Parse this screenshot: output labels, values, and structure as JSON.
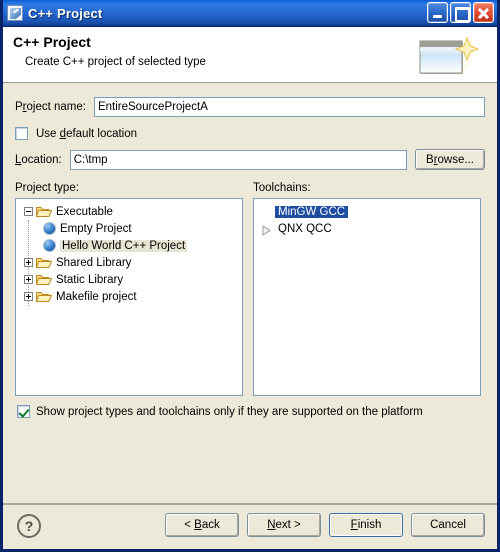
{
  "window": {
    "title": "C++ Project",
    "app_icon": "cpp-project-icon",
    "controls": {
      "minimize": "minimize-button",
      "maximize": "maximize-button",
      "close": "close-button"
    }
  },
  "header": {
    "title": "C++ Project",
    "subtitle": "Create C++ project of selected type",
    "banner_icon": "new-project-wizard-banner"
  },
  "form": {
    "project_name_label_pre": "P",
    "project_name_label_mn": "r",
    "project_name_label_post": "oject name:",
    "project_name_label": "Project name:",
    "project_name_value": "EntireSourceProjectA",
    "use_default_location_label": "Use default location",
    "use_default_location_checked": false,
    "location_label": "Location:",
    "location_value": "C:\\tmp",
    "browse_label": "Browse..."
  },
  "project_type": {
    "caption": "Project type:",
    "nodes": [
      {
        "label": "Executable",
        "level": 1,
        "icon": "folder-open-icon",
        "expander": "minus",
        "selected": false,
        "highlighted": false
      },
      {
        "label": "Empty Project",
        "level": 2,
        "icon": "sphere-icon",
        "expander": "none",
        "selected": false,
        "highlighted": false
      },
      {
        "label": "Hello World C++ Project",
        "level": 2,
        "icon": "sphere-icon",
        "expander": "none",
        "selected": false,
        "highlighted": true
      },
      {
        "label": "Shared Library",
        "level": 1,
        "icon": "folder-open-icon",
        "expander": "plus",
        "selected": false,
        "highlighted": false
      },
      {
        "label": "Static Library",
        "level": 1,
        "icon": "folder-open-icon",
        "expander": "plus",
        "selected": false,
        "highlighted": false
      },
      {
        "label": "Makefile project",
        "level": 1,
        "icon": "folder-open-icon",
        "expander": "plus",
        "selected": false,
        "highlighted": false
      }
    ]
  },
  "toolchains": {
    "caption": "Toolchains:",
    "items": [
      {
        "label": "MinGW GCC",
        "icon": "none",
        "selected": true
      },
      {
        "label": "QNX QCC",
        "icon": "triangle-right-icon",
        "selected": false
      }
    ]
  },
  "options": {
    "show_supported_label": "Show project types and toolchains only if they are supported on the platform",
    "show_supported_checked": true
  },
  "buttons": {
    "help": "?",
    "back": "< Back",
    "next": "Next >",
    "finish": "Finish",
    "cancel": "Cancel"
  },
  "colors": {
    "titlebar_blue": "#2467d0",
    "dialog_bg": "#ece9d8",
    "selection_blue": "#1f4ea1",
    "field_border": "#7f9db9",
    "highlight_row": "#e8e4d4",
    "close_red": "#c03018"
  }
}
